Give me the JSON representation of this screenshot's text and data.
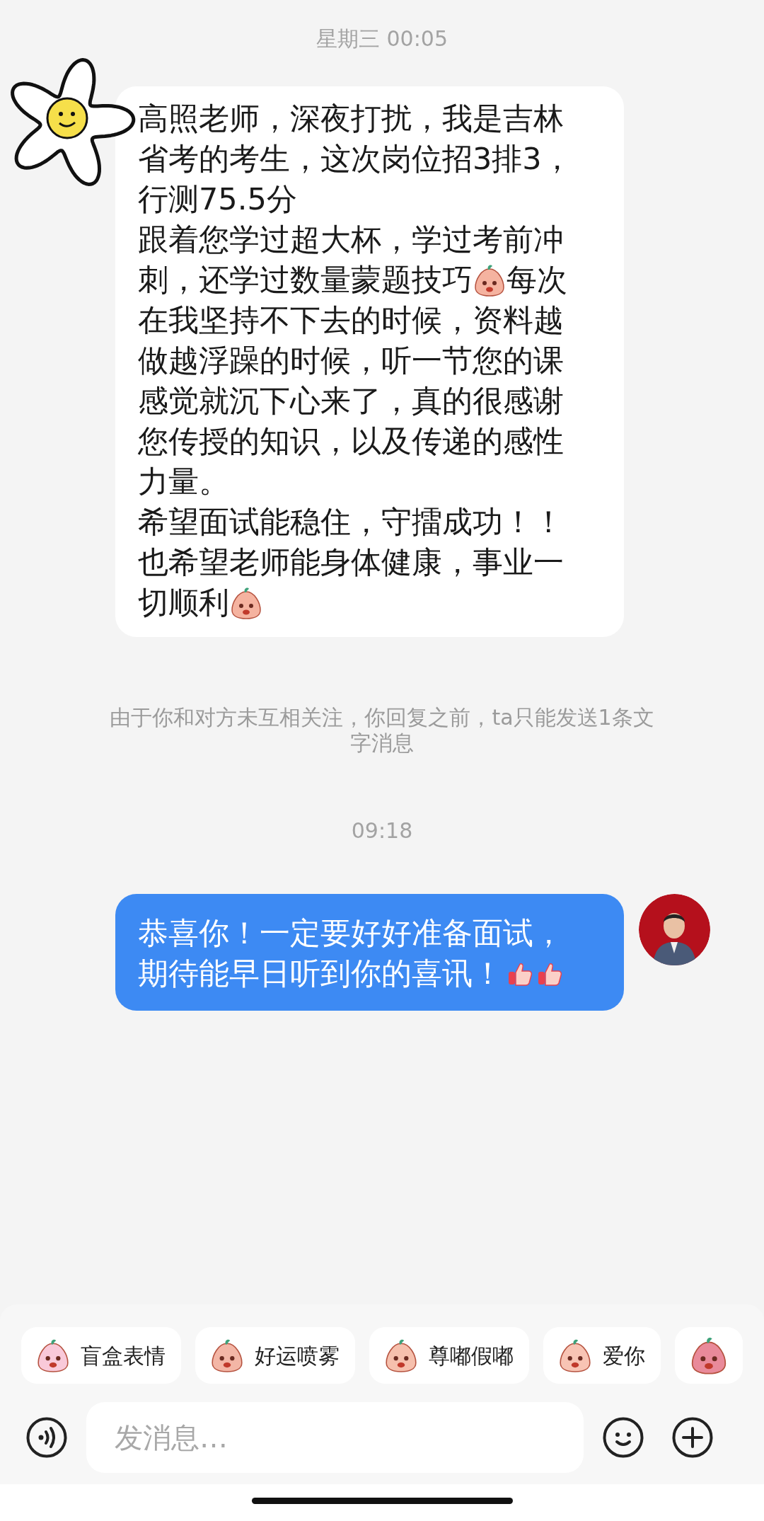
{
  "messages": [
    {
      "kind": "timestamp",
      "text": "星期三 00:05"
    },
    {
      "kind": "incoming",
      "lines": [
        [
          {
            "kind": "text",
            "text": "高照老师，深夜打扰，我是吉林"
          }
        ],
        [
          {
            "kind": "text",
            "text": "省考的考生，这次岗位招3排3，"
          }
        ],
        [
          {
            "kind": "text",
            "text": "行测75.5分"
          }
        ],
        [
          {
            "kind": "text",
            "text": "跟着您学过超大杯，学过考前冲"
          }
        ],
        [
          {
            "kind": "text",
            "text": "刺，还学过数量蒙题技巧"
          },
          {
            "kind": "sticker"
          },
          {
            "kind": "text",
            "text": "每次"
          }
        ],
        [
          {
            "kind": "text",
            "text": "在我坚持不下去的时候，资料越"
          }
        ],
        [
          {
            "kind": "text",
            "text": "做越浮躁的时候，听一节您的课"
          }
        ],
        [
          {
            "kind": "text",
            "text": "感觉就沉下心来了，真的很感谢"
          }
        ],
        [
          {
            "kind": "text",
            "text": "您传授的知识，以及传递的感性"
          }
        ],
        [
          {
            "kind": "text",
            "text": "力量。"
          }
        ],
        [
          {
            "kind": "text",
            "text": "希望面试能稳住，守擂成功！！"
          }
        ],
        [
          {
            "kind": "text",
            "text": "也希望老师能身体健康，事业一"
          }
        ],
        [
          {
            "kind": "text",
            "text": "切顺利"
          },
          {
            "kind": "sticker"
          }
        ]
      ]
    },
    {
      "kind": "notice",
      "text": "由于你和对方未互相关注，你回复之前，ta只能发送1条文字消息"
    },
    {
      "kind": "timestamp",
      "text": "09:18"
    },
    {
      "kind": "outgoing",
      "lines": [
        [
          {
            "kind": "text",
            "text": "恭喜你！一定要好好准备面试，"
          }
        ],
        [
          {
            "kind": "text",
            "text": "期待能早日听到你的喜讯！"
          },
          {
            "kind": "thumbs_up"
          },
          {
            "kind": "thumbs_up"
          }
        ]
      ]
    }
  ],
  "quick_stickers": [
    {
      "kind": "labeled",
      "label": "盲盒表情"
    },
    {
      "kind": "labeled",
      "label": "好运喷雾"
    },
    {
      "kind": "labeled",
      "label": "尊嘟假嘟"
    },
    {
      "kind": "labeled",
      "label": "爱你"
    },
    {
      "kind": "sticker_only"
    }
  ],
  "composer": {
    "placeholder": "发消息…"
  }
}
